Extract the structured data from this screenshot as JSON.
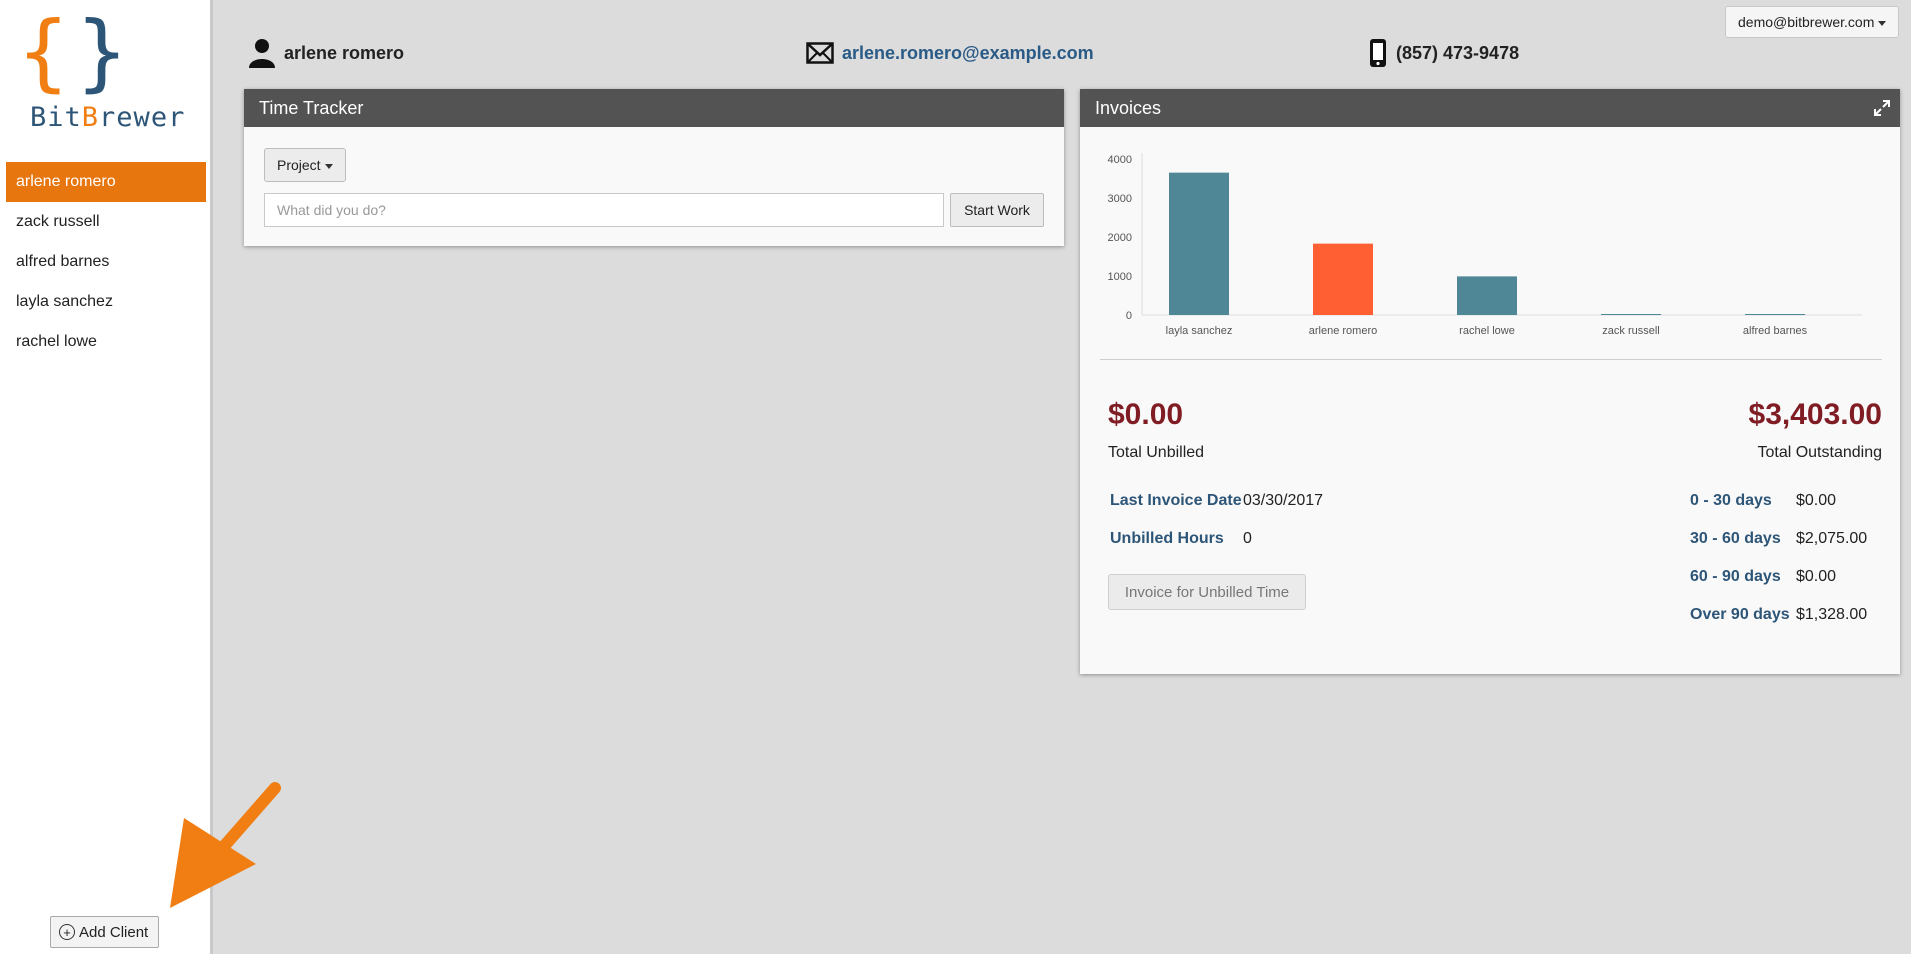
{
  "brand": {
    "name_start": "Bit",
    "name_mid": "B",
    "name_end": "rewer",
    "accent_color": "#e8760f",
    "secondary_color": "#2d5577"
  },
  "account": {
    "email": "demo@bitbrewer.com"
  },
  "sidebar": {
    "clients": [
      {
        "name": "arlene romero",
        "active": true
      },
      {
        "name": "zack russell",
        "active": false
      },
      {
        "name": "alfred barnes",
        "active": false
      },
      {
        "name": "layla sanchez",
        "active": false
      },
      {
        "name": "rachel lowe",
        "active": false
      }
    ],
    "add_client_label": "Add Client"
  },
  "contact": {
    "name": "arlene romero",
    "email": "arlene.romero@example.com",
    "phone": "(857) 473-9478"
  },
  "time_tracker": {
    "title": "Time Tracker",
    "project_label": "Project",
    "input_placeholder": "What did you do?",
    "input_value": "",
    "start_label": "Start Work"
  },
  "invoices": {
    "title": "Invoices",
    "total_unbilled": "$0.00",
    "total_unbilled_label": "Total Unbilled",
    "total_outstanding": "$3,403.00",
    "total_outstanding_label": "Total Outstanding",
    "last_invoice_date_label": "Last Invoice Date",
    "last_invoice_date": "03/30/2017",
    "unbilled_hours_label": "Unbilled Hours",
    "unbilled_hours": "0",
    "invoice_button_label": "Invoice for Unbilled Time",
    "aging": [
      {
        "label": "0 - 30 days",
        "value": "$0.00"
      },
      {
        "label": "30 - 60 days",
        "value": "$2,075.00"
      },
      {
        "label": "60 - 90 days",
        "value": "$0.00"
      },
      {
        "label": "Over 90 days",
        "value": "$1,328.00"
      }
    ]
  },
  "chart_data": {
    "type": "bar",
    "categories": [
      "layla sanchez",
      "arlene romero",
      "rachel lowe",
      "zack russell",
      "alfred barnes"
    ],
    "values": [
      3650,
      1830,
      990,
      0,
      0
    ],
    "highlight": "arlene romero",
    "colors": {
      "default": "#4f8796",
      "highlight": "#ff5f33"
    },
    "ylim": [
      0,
      4000
    ],
    "yticks": [
      0,
      1000,
      2000,
      3000,
      4000
    ],
    "title": "",
    "xlabel": "",
    "ylabel": ""
  }
}
